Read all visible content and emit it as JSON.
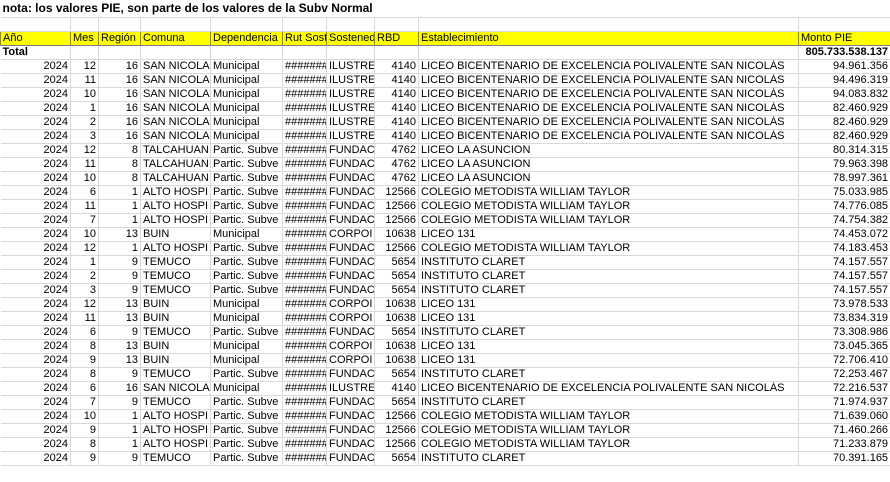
{
  "note": "nota: los valores PIE, son parte de los valores de la Subv Normal",
  "headers": [
    "Año",
    "Mes",
    "Región",
    "Comuna",
    "Dependencia",
    "Rut Sost",
    "Sostenedor",
    "RBD",
    "Establecimiento",
    "Monto PIE"
  ],
  "total": {
    "label": "Total",
    "value": "805.733.538.137"
  },
  "rows": [
    [
      "2024",
      "12",
      "16",
      "SAN NICOLA",
      "Municipal",
      "#######",
      "ILUSTRE",
      "4140",
      "LICEO BICENTENARIO DE EXCELENCIA POLIVALENTE SAN NICOLÁS",
      "94.961.356"
    ],
    [
      "2024",
      "11",
      "16",
      "SAN NICOLA",
      "Municipal",
      "#######",
      "ILUSTRE",
      "4140",
      "LICEO BICENTENARIO DE EXCELENCIA POLIVALENTE SAN NICOLÁS",
      "94.496.319"
    ],
    [
      "2024",
      "10",
      "16",
      "SAN NICOLA",
      "Municipal",
      "#######",
      "ILUSTRE",
      "4140",
      "LICEO BICENTENARIO DE EXCELENCIA POLIVALENTE SAN NICOLÁS",
      "94.083.832"
    ],
    [
      "2024",
      "1",
      "16",
      "SAN NICOLA",
      "Municipal",
      "#######",
      "ILUSTRE",
      "4140",
      "LICEO BICENTENARIO DE EXCELENCIA POLIVALENTE SAN NICOLÁS",
      "82.460.929"
    ],
    [
      "2024",
      "2",
      "16",
      "SAN NICOLA",
      "Municipal",
      "#######",
      "ILUSTRE",
      "4140",
      "LICEO BICENTENARIO DE EXCELENCIA POLIVALENTE SAN NICOLÁS",
      "82.460.929"
    ],
    [
      "2024",
      "3",
      "16",
      "SAN NICOLA",
      "Municipal",
      "#######",
      "ILUSTRE",
      "4140",
      "LICEO BICENTENARIO DE EXCELENCIA POLIVALENTE SAN NICOLÁS",
      "82.460.929"
    ],
    [
      "2024",
      "12",
      "8",
      "TALCAHUAN",
      "Partic. Subve",
      "#######",
      "FUNDAC",
      "4762",
      "LICEO LA ASUNCION",
      "80.314.315"
    ],
    [
      "2024",
      "11",
      "8",
      "TALCAHUAN",
      "Partic. Subve",
      "#######",
      "FUNDAC",
      "4762",
      "LICEO LA ASUNCION",
      "79.963.398"
    ],
    [
      "2024",
      "10",
      "8",
      "TALCAHUAN",
      "Partic. Subve",
      "#######",
      "FUNDAC",
      "4762",
      "LICEO LA ASUNCION",
      "78.997.361"
    ],
    [
      "2024",
      "6",
      "1",
      "ALTO HOSPI",
      "Partic. Subve",
      "#######",
      "FUNDAC",
      "12566",
      "COLEGIO METODISTA WILLIAM TAYLOR",
      "75.033.985"
    ],
    [
      "2024",
      "11",
      "1",
      "ALTO HOSPI",
      "Partic. Subve",
      "#######",
      "FUNDAC",
      "12566",
      "COLEGIO METODISTA WILLIAM TAYLOR",
      "74.776.085"
    ],
    [
      "2024",
      "7",
      "1",
      "ALTO HOSPI",
      "Partic. Subve",
      "#######",
      "FUNDAC",
      "12566",
      "COLEGIO METODISTA WILLIAM TAYLOR",
      "74.754.382"
    ],
    [
      "2024",
      "10",
      "13",
      "BUIN",
      "Municipal",
      "#######",
      "CORPOI",
      "10638",
      "LICEO 131",
      "74.453.072"
    ],
    [
      "2024",
      "12",
      "1",
      "ALTO HOSPI",
      "Partic. Subve",
      "#######",
      "FUNDAC",
      "12566",
      "COLEGIO METODISTA WILLIAM TAYLOR",
      "74.183.453"
    ],
    [
      "2024",
      "1",
      "9",
      "TEMUCO",
      "Partic. Subve",
      "#######",
      "FUNDAC",
      "5654",
      "INSTITUTO CLARET",
      "74.157.557"
    ],
    [
      "2024",
      "2",
      "9",
      "TEMUCO",
      "Partic. Subve",
      "#######",
      "FUNDAC",
      "5654",
      "INSTITUTO CLARET",
      "74.157.557"
    ],
    [
      "2024",
      "3",
      "9",
      "TEMUCO",
      "Partic. Subve",
      "#######",
      "FUNDAC",
      "5654",
      "INSTITUTO CLARET",
      "74.157.557"
    ],
    [
      "2024",
      "12",
      "13",
      "BUIN",
      "Municipal",
      "#######",
      "CORPOI",
      "10638",
      "LICEO 131",
      "73.978.533"
    ],
    [
      "2024",
      "11",
      "13",
      "BUIN",
      "Municipal",
      "#######",
      "CORPOI",
      "10638",
      "LICEO 131",
      "73.834.319"
    ],
    [
      "2024",
      "6",
      "9",
      "TEMUCO",
      "Partic. Subve",
      "#######",
      "FUNDAC",
      "5654",
      "INSTITUTO CLARET",
      "73.308.986"
    ],
    [
      "2024",
      "8",
      "13",
      "BUIN",
      "Municipal",
      "#######",
      "CORPOI",
      "10638",
      "LICEO 131",
      "73.045.365"
    ],
    [
      "2024",
      "9",
      "13",
      "BUIN",
      "Municipal",
      "#######",
      "CORPOI",
      "10638",
      "LICEO 131",
      "72.706.410"
    ],
    [
      "2024",
      "8",
      "9",
      "TEMUCO",
      "Partic. Subve",
      "#######",
      "FUNDAC",
      "5654",
      "INSTITUTO CLARET",
      "72.253.467"
    ],
    [
      "2024",
      "6",
      "16",
      "SAN NICOLA",
      "Municipal",
      "#######",
      "ILUSTRE",
      "4140",
      "LICEO BICENTENARIO DE EXCELENCIA POLIVALENTE SAN NICOLÁS",
      "72.216.537"
    ],
    [
      "2024",
      "7",
      "9",
      "TEMUCO",
      "Partic. Subve",
      "#######",
      "FUNDAC",
      "5654",
      "INSTITUTO CLARET",
      "71.974.937"
    ],
    [
      "2024",
      "10",
      "1",
      "ALTO HOSPI",
      "Partic. Subve",
      "#######",
      "FUNDAC",
      "12566",
      "COLEGIO METODISTA WILLIAM TAYLOR",
      "71.639.060"
    ],
    [
      "2024",
      "9",
      "1",
      "ALTO HOSPI",
      "Partic. Subve",
      "#######",
      "FUNDAC",
      "12566",
      "COLEGIO METODISTA WILLIAM TAYLOR",
      "71.460.266"
    ],
    [
      "2024",
      "8",
      "1",
      "ALTO HOSPI",
      "Partic. Subve",
      "#######",
      "FUNDAC",
      "12566",
      "COLEGIO METODISTA WILLIAM TAYLOR",
      "71.233.879"
    ],
    [
      "2024",
      "9",
      "9",
      "TEMUCO",
      "Partic. Subve",
      "#######",
      "FUNDAC",
      "5654",
      "INSTITUTO CLARET",
      "70.391.165"
    ]
  ],
  "colors": {
    "header_fill": "#ffff00",
    "gridline": "#d9d9d9"
  }
}
